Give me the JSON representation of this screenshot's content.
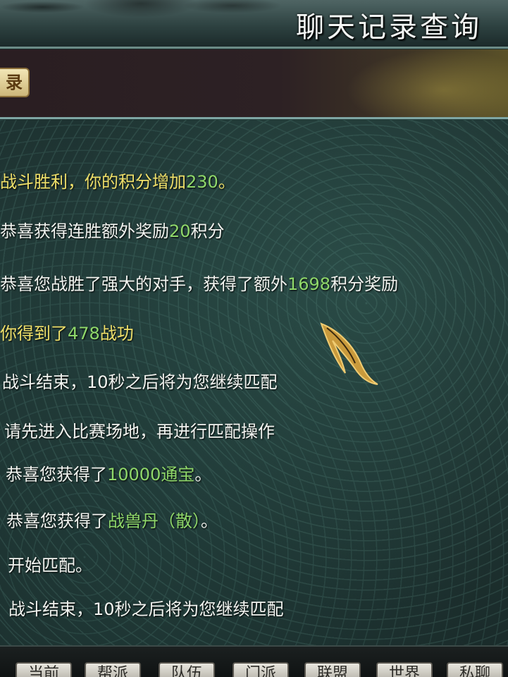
{
  "window": {
    "title": "聊天记录查询"
  },
  "tabs": {
    "record_tab_label": "录"
  },
  "messages": [
    {
      "parts": [
        {
          "text": "战斗胜利，你的积分增加",
          "color": "yellow"
        },
        {
          "text": "230",
          "color": "green"
        },
        {
          "text": "。",
          "color": "yellow"
        }
      ]
    },
    {
      "parts": [
        {
          "text": "恭喜获得连胜额外奖励",
          "color": "white"
        },
        {
          "text": "20",
          "color": "green"
        },
        {
          "text": "积分",
          "color": "white"
        }
      ]
    },
    {
      "parts": [
        {
          "text": "恭喜您战胜了强大的对手，获得了额外",
          "color": "white"
        },
        {
          "text": "1698",
          "color": "green"
        },
        {
          "text": "积分奖励",
          "color": "white"
        }
      ]
    },
    {
      "parts": [
        {
          "text": "你得到了",
          "color": "yellow"
        },
        {
          "text": "478",
          "color": "green"
        },
        {
          "text": "战功",
          "color": "yellow"
        }
      ]
    },
    {
      "parts": [
        {
          "text": "战斗结束，10秒之后将为您继续匹配",
          "color": "white"
        }
      ]
    },
    {
      "parts": [
        {
          "text": "请先进入比赛场地，再进行匹配操作",
          "color": "white"
        }
      ]
    },
    {
      "parts": [
        {
          "text": "恭喜您获得了",
          "color": "white"
        },
        {
          "text": "10000通宝",
          "color": "green"
        },
        {
          "text": "。",
          "color": "white"
        }
      ]
    },
    {
      "parts": [
        {
          "text": "恭喜您获得了",
          "color": "white"
        },
        {
          "text": "战兽丹（散）",
          "color": "green"
        },
        {
          "text": "。",
          "color": "white"
        }
      ]
    },
    {
      "parts": [
        {
          "text": "开始匹配。",
          "color": "white"
        }
      ]
    },
    {
      "parts": [
        {
          "text": "战斗结束，10秒之后将为您继续匹配",
          "color": "white"
        }
      ]
    }
  ],
  "bottom_buttons": [
    {
      "label": "当前"
    },
    {
      "label": "帮派"
    },
    {
      "label": "队伍"
    },
    {
      "label": "门派"
    },
    {
      "label": "联盟"
    },
    {
      "label": "世界"
    },
    {
      "label": "私聊"
    }
  ],
  "colors": {
    "white": "#f2f4f0",
    "yellow": "#efe06a",
    "green": "#8fd86a"
  }
}
